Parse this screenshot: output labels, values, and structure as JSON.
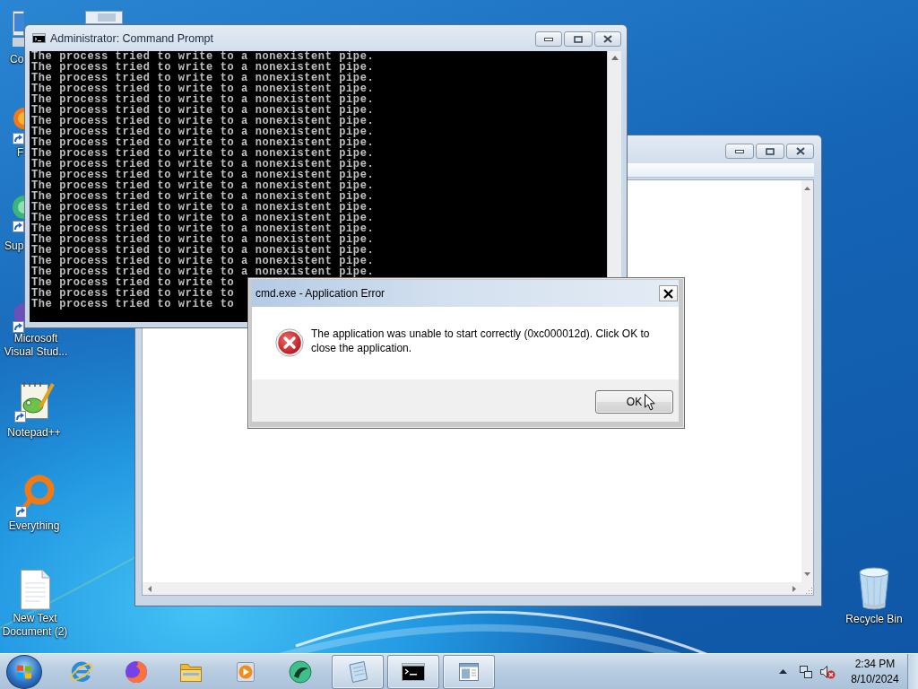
{
  "desktop_icons": [
    {
      "label": "Co",
      "shortcut": false
    },
    {
      "label": "F",
      "shortcut": true
    },
    {
      "label": "Sup",
      "shortcut": true
    },
    {
      "label": "Microsoft Visual Stud...",
      "shortcut": true
    },
    {
      "label": "Notepad++",
      "shortcut": true
    },
    {
      "label": "Everything",
      "shortcut": true
    },
    {
      "label": "New Text Document (2)",
      "shortcut": false
    },
    {
      "label": "Recycle Bin",
      "shortcut": false
    }
  ],
  "command_prompt": {
    "title": "Administrator: Command Prompt",
    "lines": [
      "The process tried to write to a nonexistent pipe.",
      "The process tried to write to a nonexistent pipe.",
      "The process tried to write to a nonexistent pipe.",
      "The process tried to write to a nonexistent pipe.",
      "The process tried to write to a nonexistent pipe.",
      "The process tried to write to a nonexistent pipe.",
      "The process tried to write to a nonexistent pipe.",
      "The process tried to write to a nonexistent pipe.",
      "The process tried to write to a nonexistent pipe.",
      "The process tried to write to a nonexistent pipe.",
      "The process tried to write to a nonexistent pipe.",
      "The process tried to write to a nonexistent pipe.",
      "The process tried to write to a nonexistent pipe.",
      "The process tried to write to a nonexistent pipe.",
      "The process tried to write to a nonexistent pipe.",
      "The process tried to write to a nonexistent pipe.",
      "The process tried to write to a nonexistent pipe.",
      "The process tried to write to a nonexistent pipe.",
      "The process tried to write to a nonexistent pipe.",
      "The process tried to write to a nonexistent pipe.",
      "The process tried to write to a nonexistent pipe.",
      "The process tried to write to",
      "The process tried to write to",
      "The process tried to write to"
    ]
  },
  "error_dialog": {
    "title": "cmd.exe - Application Error",
    "message": "The application was unable to start correctly (0xc000012d). Click OK to close the application.",
    "buttons": [
      "OK"
    ]
  },
  "taskbar": {
    "apps": [
      {
        "running": false
      },
      {
        "running": false
      },
      {
        "running": false
      },
      {
        "running": false
      },
      {
        "running": false
      },
      {
        "running": true
      },
      {
        "running": true
      },
      {
        "running": true
      }
    ],
    "tray": {
      "volume_muted": true
    },
    "clock": {
      "time": "2:34 PM",
      "date": "8/10/2024"
    }
  }
}
